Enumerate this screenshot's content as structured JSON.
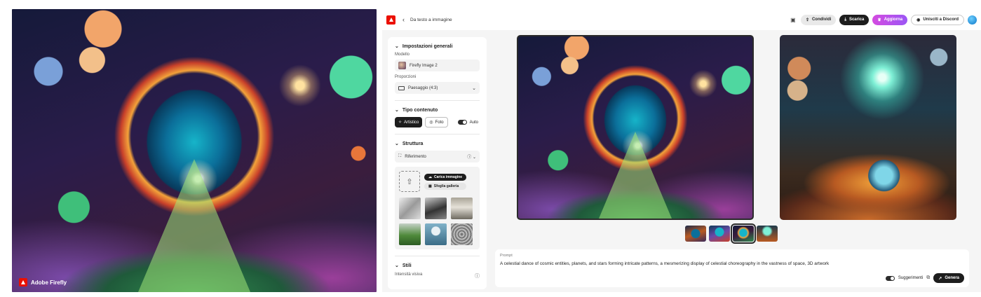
{
  "showcase": {
    "badge_label": "Adobe Firefly"
  },
  "topbar": {
    "back_label": "Da testo a immagine",
    "share_label": "Condividi",
    "download_label": "Scarica",
    "upgrade_label": "Aggiorna",
    "discord_label": "Unisciti a Discord"
  },
  "panel": {
    "general": {
      "title": "Impostazioni generali",
      "model_label": "Modello",
      "model_value": "Firefly Image 2",
      "ratio_label": "Proporzioni",
      "ratio_value": "Paesaggio (4:3)"
    },
    "content_type": {
      "title": "Tipo contenuto",
      "artistic_label": "Artistico",
      "photo_label": "Foto",
      "auto_label": "Auto",
      "selected": "Artistico",
      "auto_on": true
    },
    "structure": {
      "title": "Struttura",
      "reference_label": "Riferimento",
      "upload_label": "Carica immagine",
      "browse_label": "Sfoglia galleria"
    },
    "styles": {
      "title": "Stili",
      "intensity_label": "Intensità visiva"
    }
  },
  "gallery": {
    "thumbnail_count": 4,
    "selected_index": 2
  },
  "prompt": {
    "label": "Prompt",
    "text": "A celestial dance of cosmic entities, planets, and stars forming intricate patterns, a mesmerizing display of celestial choreography in the vastness of space, 3D artwork",
    "suggestions_label": "Suggerimenti",
    "suggestions_on": true,
    "generate_label": "Genera"
  },
  "colors": {
    "adobe_red": "#eb1000",
    "dark_button": "#1d1d1d",
    "upgrade_gradient_start": "#d44be0",
    "upgrade_gradient_end": "#9b56f5"
  },
  "icons": [
    "adobe-logo-icon",
    "chevron-left-icon",
    "feedback-icon",
    "share-icon",
    "download-icon",
    "crown-icon",
    "discord-icon",
    "chevron-down-icon",
    "palette-icon",
    "camera-icon",
    "reference-icon",
    "info-icon",
    "upload-icon",
    "gallery-icon",
    "suggestions-icon",
    "generate-icon"
  ]
}
